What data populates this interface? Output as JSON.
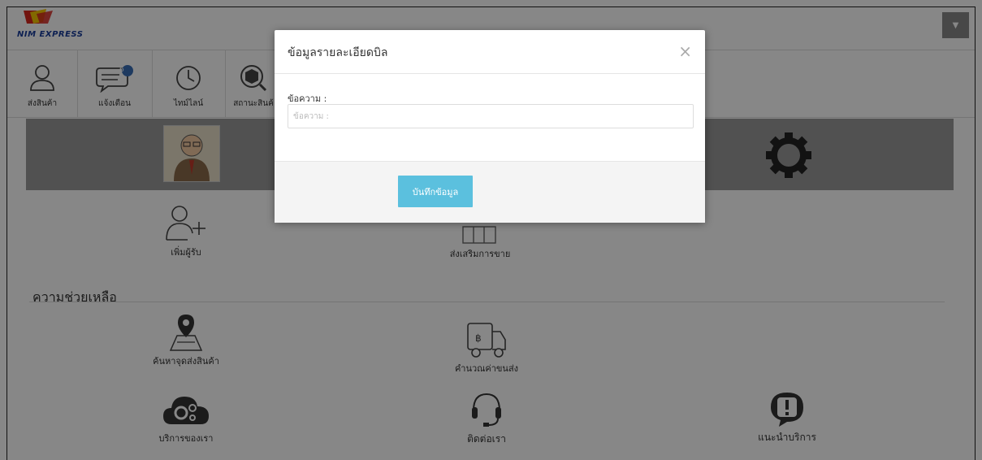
{
  "header": {
    "logo_text": "NIM EXPRESS",
    "dropdown_icon": "caret-down-icon"
  },
  "toolbar": {
    "items": [
      {
        "label": "ส่งสินค้า",
        "icon": "user-icon"
      },
      {
        "label": "แจ้งเตือน",
        "icon": "chat-bubble-icon",
        "badge": "6"
      },
      {
        "label": "ไทม์ไลน์",
        "icon": "clock-icon"
      },
      {
        "label": "สถานะสินค้",
        "icon": "box-search-icon"
      }
    ]
  },
  "features": {
    "add_recipient": "เพิ่มผู้รับ",
    "promo": "ส่งเสริมการขาย",
    "find_location": "ค้นหาจุดส่งสินค้า",
    "calc_shipping": "คำนวณค่าขนส่ง",
    "our_services": "บริการของเรา",
    "contact_us": "ติดต่อเรา",
    "recommend": "แนะนำบริการ"
  },
  "help": {
    "title": "ความช่วยเหลือ"
  },
  "modal": {
    "title": "ข้อมูลรายละเอียดบิล",
    "close": "×",
    "field_label": "ข้อความ :",
    "field_placeholder": "ข้อความ :",
    "field_value": "",
    "save_label": "บันทึกข้อมูล"
  },
  "colors": {
    "banner": "#9a9a9a",
    "overlay": "rgba(0,0,0,0.47)",
    "save_button": "#5bc0de",
    "logo_blue": "#1a3e9c",
    "logo_red": "#d7261e",
    "logo_yellow": "#f5c400",
    "badge": "#3a6fb5"
  }
}
